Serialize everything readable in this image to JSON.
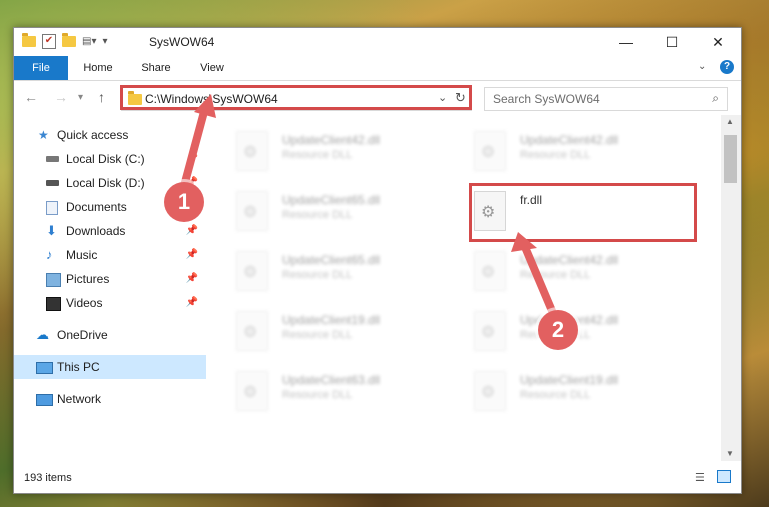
{
  "window": {
    "title": "SysWOW64",
    "controls": [
      "—",
      "☐",
      "✕"
    ]
  },
  "ribbon": {
    "tabs": [
      "File",
      "Home",
      "Share",
      "View"
    ]
  },
  "address": {
    "path": "C:\\Windows\\SysWOW64",
    "search_placeholder": "Search SysWOW64"
  },
  "sidebar": {
    "items": [
      {
        "label": "Quick access",
        "icon": "star-icon"
      },
      {
        "label": "Local Disk (C:)",
        "icon": "drive-icon"
      },
      {
        "label": "Local Disk (D:)",
        "icon": "drive-icon"
      },
      {
        "label": "Documents",
        "icon": "documents-icon"
      },
      {
        "label": "Downloads",
        "icon": "download-icon"
      },
      {
        "label": "Music",
        "icon": "music-icon"
      },
      {
        "label": "Pictures",
        "icon": "pictures-icon"
      },
      {
        "label": "Videos",
        "icon": "video-icon"
      },
      {
        "label": "OneDrive",
        "icon": "cloud-icon"
      },
      {
        "label": "This PC",
        "icon": "monitor-icon"
      },
      {
        "label": "Network",
        "icon": "network-icon"
      }
    ]
  },
  "files": [
    {
      "name": "UpdateClient42.dll",
      "type": "Resource DLL"
    },
    {
      "name": "UpdateClient42.dll",
      "type": "Resource DLL"
    },
    {
      "name": "UpdateClient65.dll",
      "type": "Resource DLL"
    },
    {
      "name": "fr.dll",
      "type": ""
    },
    {
      "name": "UpdateClient65.dll",
      "type": "Resource DLL"
    },
    {
      "name": "UpdateClient42.dll",
      "type": "Resource DLL"
    },
    {
      "name": "UpdateClient19.dll",
      "type": "Resource DLL"
    },
    {
      "name": "UpdateClient42.dll",
      "type": "Resource DLL"
    },
    {
      "name": "UpdateClient63.dll",
      "type": "Resource DLL"
    },
    {
      "name": "UpdateClient19.dll",
      "type": "Resource DLL"
    }
  ],
  "status": {
    "items_count": "193 items"
  },
  "callouts": {
    "one": "1",
    "two": "2"
  },
  "colors": {
    "accent": "#1979ca",
    "highlight": "#d44a4a",
    "selected": "#cde8ff"
  }
}
